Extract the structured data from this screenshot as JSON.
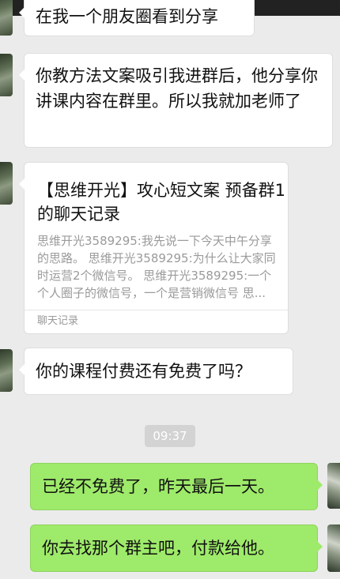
{
  "messages": {
    "m1": "在我一个朋友圈看到分享",
    "m2": "你教方法文案吸引我进群后，他分享你讲课内容在群里。所以我就加老师了",
    "m3": "你的课程付费还有免费了吗？",
    "m4": "已经不免费了，昨天最后一天。",
    "m5": "你去找那个群主吧，付款给他。"
  },
  "card": {
    "title": "【思维开光】攻心短文案 预备群1的聊天记录",
    "body": "思维开光3589295:我先说一下今天中午分享的思路。 思维开光3589295:为什么让大家同时运营2个微信号。 思维开光3589295:一个个人圈子的微信号，一个是营销微信号 思...",
    "footer": "聊天记录"
  },
  "timestamp": "09:37",
  "icons": {
    "contact_avatar": "avatar-photo",
    "self_avatar": "avatar-photo"
  }
}
